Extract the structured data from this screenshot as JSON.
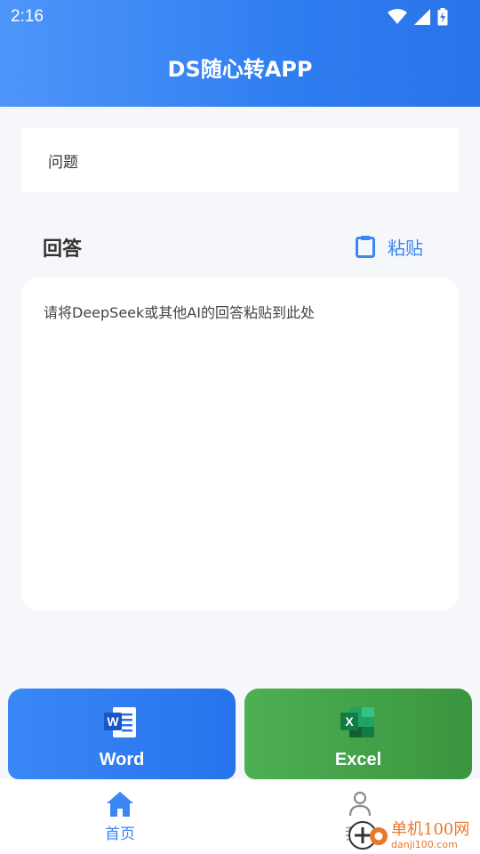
{
  "status_bar": {
    "time": "2:16"
  },
  "header": {
    "title": "DS随心转APP"
  },
  "question": {
    "label": "问题"
  },
  "answer": {
    "label": "回答",
    "paste_label": "粘贴",
    "placeholder": "请将DeepSeek或其他AI的回答粘贴到此处"
  },
  "actions": {
    "word_label": "Word",
    "word_icon_letter": "W",
    "excel_label": "Excel",
    "excel_icon_letter": "X"
  },
  "nav": {
    "home_label": "首页",
    "mine_label": "我的"
  },
  "watermark": {
    "main": "单机100网",
    "sub": "danji100.com"
  },
  "colors": {
    "accent": "#3a86f3",
    "word": "#2574ec",
    "excel": "#3a963e",
    "background": "#f5f7fa"
  }
}
